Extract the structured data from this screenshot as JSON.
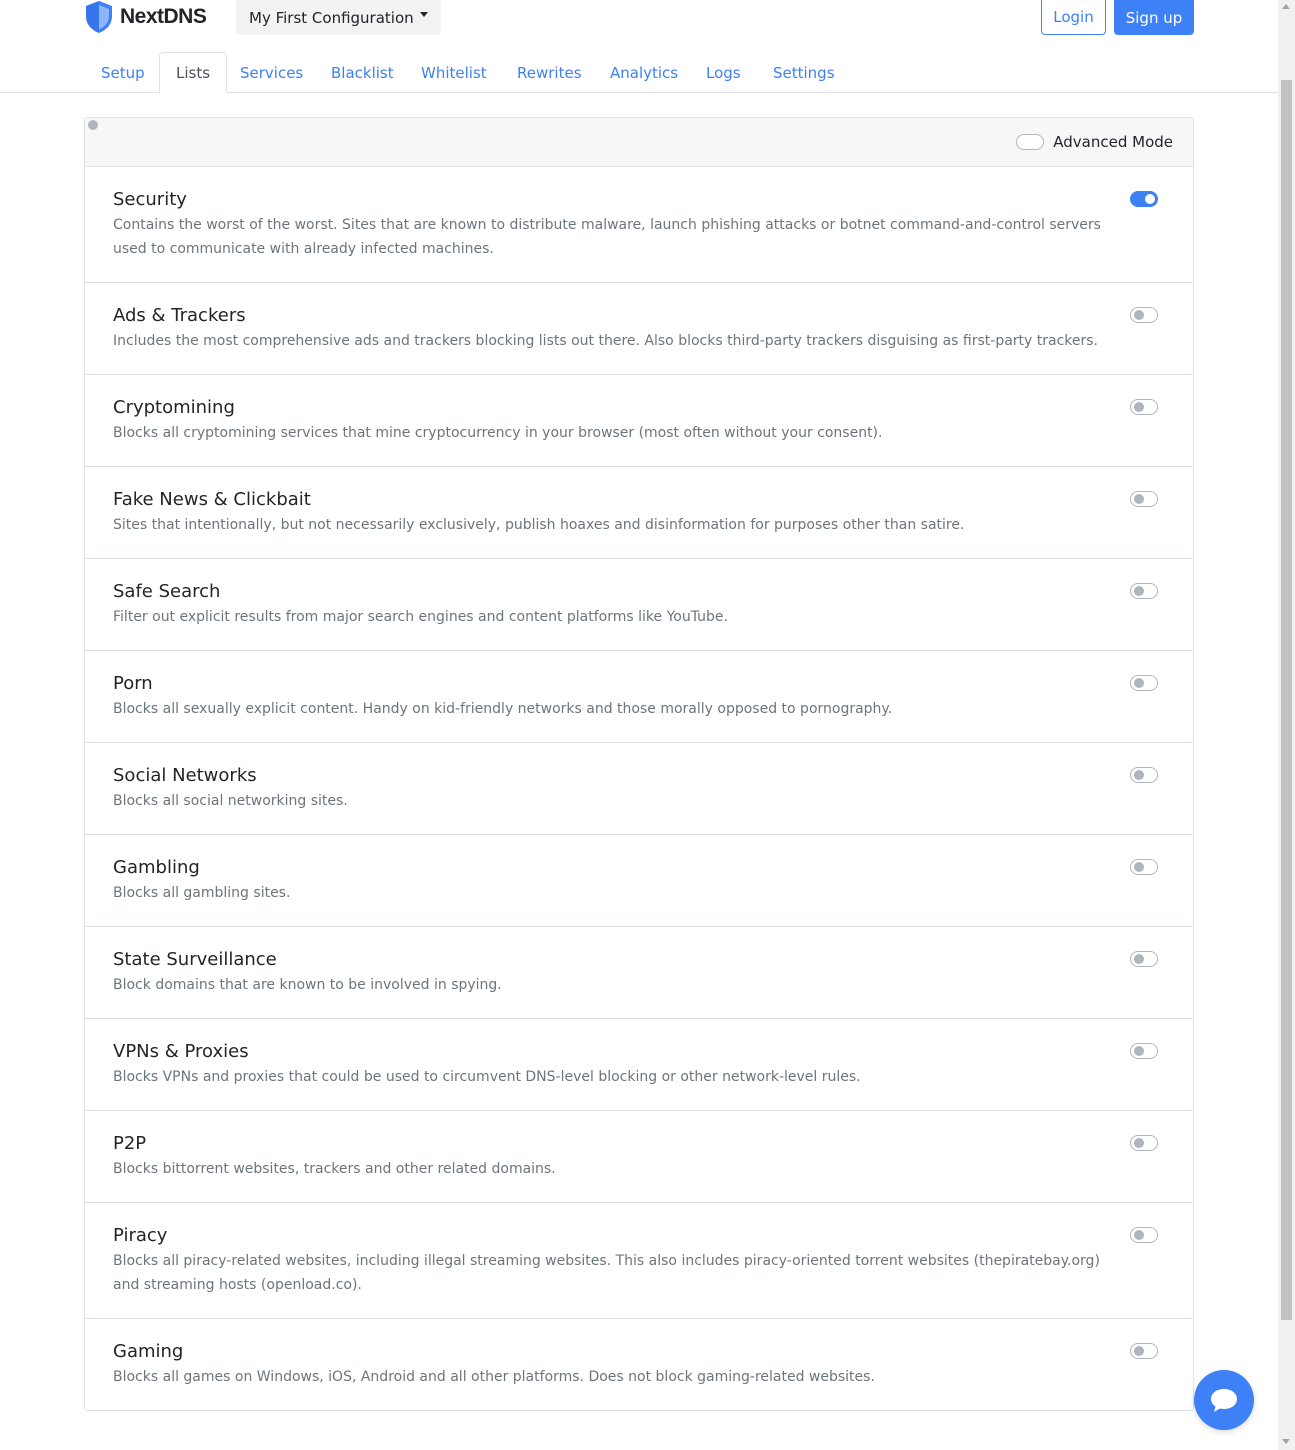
{
  "header": {
    "brand": "NextDNS",
    "config_label": "My First Configuration",
    "login_label": "Login",
    "signup_label": "Sign up"
  },
  "tabs": [
    {
      "label": "Setup",
      "active": false
    },
    {
      "label": "Lists",
      "active": true
    },
    {
      "label": "Services",
      "active": false
    },
    {
      "label": "Blacklist",
      "active": false
    },
    {
      "label": "Whitelist",
      "active": false
    },
    {
      "label": "Rewrites",
      "active": false
    },
    {
      "label": "Analytics",
      "active": false
    },
    {
      "label": "Logs",
      "active": false
    },
    {
      "label": "Settings",
      "active": false
    }
  ],
  "advanced_mode": {
    "label": "Advanced Mode",
    "enabled": false
  },
  "lists": [
    {
      "title": "Security",
      "description": "Contains the worst of the worst. Sites that are known to distribute malware, launch phishing attacks or botnet command-and-control servers used to communicate with already infected machines.",
      "enabled": true
    },
    {
      "title": "Ads & Trackers",
      "description": "Includes the most comprehensive ads and trackers blocking lists out there. Also blocks third-party trackers disguising as first-party trackers.",
      "enabled": false
    },
    {
      "title": "Cryptomining",
      "description": "Blocks all cryptomining services that mine cryptocurrency in your browser (most often without your consent).",
      "enabled": false
    },
    {
      "title": "Fake News & Clickbait",
      "description": "Sites that intentionally, but not necessarily exclusively, publish hoaxes and disinformation for purposes other than satire.",
      "enabled": false
    },
    {
      "title": "Safe Search",
      "description": "Filter out explicit results from major search engines and content platforms like YouTube.",
      "enabled": false
    },
    {
      "title": "Porn",
      "description": "Blocks all sexually explicit content. Handy on kid-friendly networks and those morally opposed to pornography.",
      "enabled": false
    },
    {
      "title": "Social Networks",
      "description": "Blocks all social networking sites.",
      "enabled": false
    },
    {
      "title": "Gambling",
      "description": "Blocks all gambling sites.",
      "enabled": false
    },
    {
      "title": "State Surveillance",
      "description": "Block domains that are known to be involved in spying.",
      "enabled": false
    },
    {
      "title": "VPNs & Proxies",
      "description": "Blocks VPNs and proxies that could be used to circumvent DNS-level blocking or other network-level rules.",
      "enabled": false
    },
    {
      "title": "P2P",
      "description": "Blocks bittorrent websites, trackers and other related domains.",
      "enabled": false
    },
    {
      "title": "Piracy",
      "description": "Blocks all piracy-related websites, including illegal streaming websites. This also includes piracy-oriented torrent websites (thepiratebay.org) and streaming hosts (openload.co).",
      "enabled": false
    },
    {
      "title": "Gaming",
      "description": "Blocks all games on Windows, iOS, Android and all other platforms. Does not block gaming-related websites.",
      "enabled": false
    }
  ],
  "colors": {
    "accent": "#3e80f6",
    "muted_text": "#6c757d",
    "border": "#dfe3e8"
  },
  "icons": {
    "brand": "shield-icon",
    "chat": "chat-bubble-icon"
  }
}
